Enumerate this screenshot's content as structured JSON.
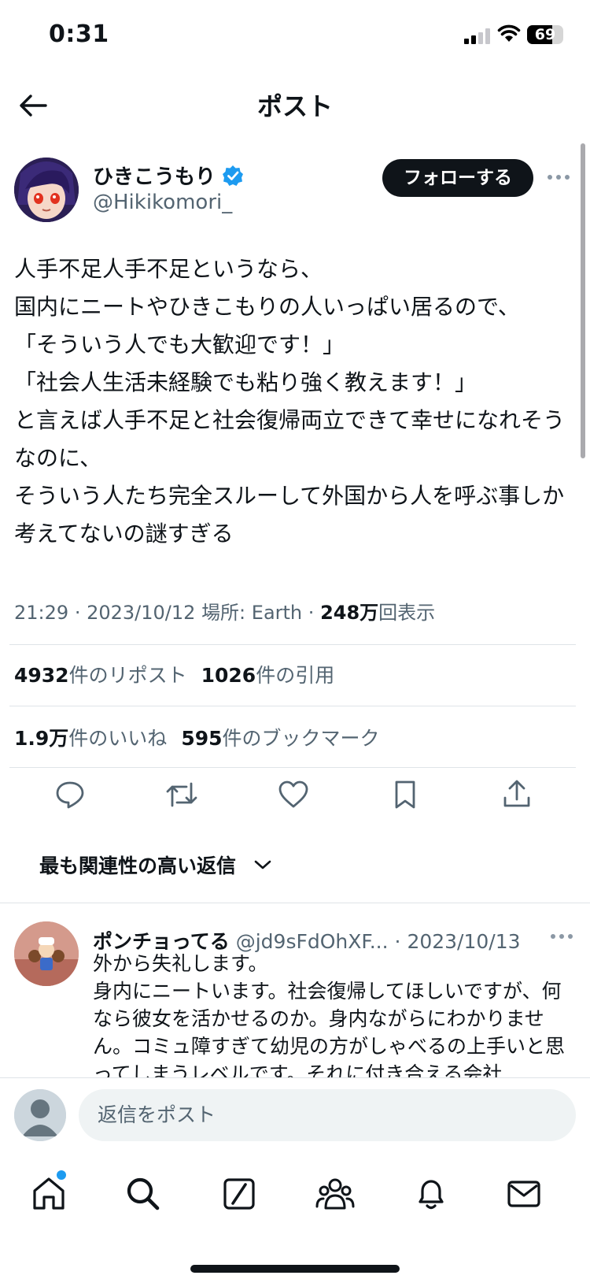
{
  "status_bar": {
    "time": "0:31",
    "battery_level": "69",
    "icons": [
      "signal-icon",
      "wifi-icon",
      "battery-icon"
    ]
  },
  "nav": {
    "back_icon": "arrow-left-icon",
    "title": "ポスト"
  },
  "author": {
    "name": "ひきこうもり",
    "handle": "@Hikikomori_",
    "verified": true,
    "follow_label": "フォローする"
  },
  "tweet": {
    "text": "人手不足人手不足というなら、\n国内にニートやひきこもりの人いっぱい居るので、\n「そういう人でも大歓迎です！」\n「社会人生活未経験でも粘り強く教えます！」\nと言えば人手不足と社会復帰両立できて幸せになれそうなのに、\nそういう人たち完全スルーして外国から人を呼ぶ事しか考えてないの謎すぎる",
    "time": "21:29",
    "sep1": "·",
    "date": "2023/10/12",
    "location": "場所: Earth",
    "sep2": "·",
    "views_num": "248万",
    "views_label": "回表示"
  },
  "stats": {
    "reposts_num": "4932",
    "reposts_label": "件のリポスト",
    "quotes_num": "1026",
    "quotes_label": "件の引用",
    "likes_num": "1.9万",
    "likes_label": "件のいいね",
    "bookmarks_num": "595",
    "bookmarks_label": "件のブックマーク"
  },
  "actions": [
    "reply-icon",
    "repost-icon",
    "like-icon",
    "bookmark-icon",
    "share-icon"
  ],
  "sort": {
    "label": "最も関連性の高い返信",
    "icon": "chevron-down-icon"
  },
  "reply": {
    "name": "ポンチョってる",
    "handle": "@jd9sFdOhXF...",
    "sep": "·",
    "date": "2023/10/13",
    "text": "外から失礼します。\n身内にニートいます。社会復帰してほしいですが、何なら彼女を活かせるのか。身内ながらにわかりません。コミュ障すぎて幼児の方がしゃべるの上手いと思ってしまうレベルです。それに付き合える会社"
  },
  "composer": {
    "placeholder": "返信をポスト"
  },
  "tabs": [
    "home-icon",
    "search-icon",
    "grok-icon",
    "communities-icon",
    "notifications-icon",
    "messages-icon"
  ],
  "colors": {
    "text": "#0f1419",
    "secondary": "#536471",
    "accent": "#1d9bf0",
    "divider": "#dfe4e8"
  }
}
